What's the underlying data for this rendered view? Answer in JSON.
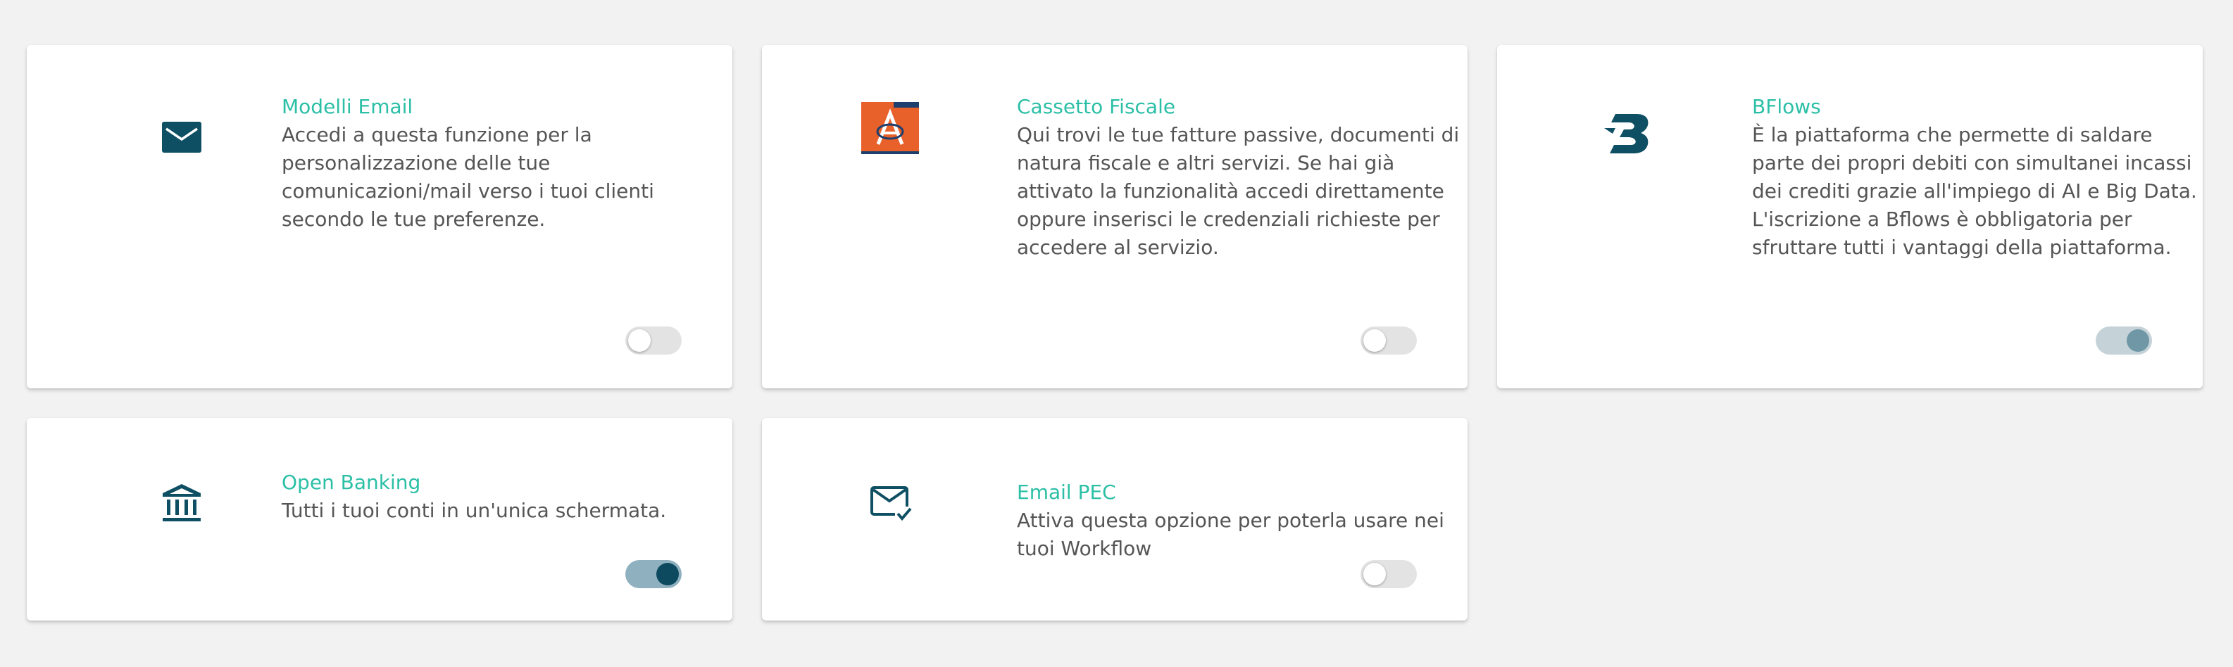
{
  "colors": {
    "background": "#f2f2f2",
    "card": "#ffffff",
    "title": "#2bbfa6",
    "text": "#555555",
    "icon": "#0f4f63",
    "fiscal_orange": "#e8602a"
  },
  "cards": [
    {
      "title": "Modelli Email",
      "description": "Accedi a questa funzione per la personalizzazione delle tue comunicazioni/mail verso i tuoi clienti secondo le tue preferenze.",
      "icon": "envelope-icon",
      "toggle": "off"
    },
    {
      "title": "Cassetto Fiscale",
      "description": "Qui trovi le tue fatture passive, documenti di natura fiscale e altri servizi. Se hai già attivato la funzionalità accedi direttamente oppure inserisci le credenziali richieste per accedere al servizio.",
      "icon": "cassetto-fiscale-logo-icon",
      "toggle": "off"
    },
    {
      "title": "BFlows",
      "description": "È la piattaforma che permette di saldare parte dei propri debiti con simultanei incassi dei crediti grazie all'impiego di AI e Big Data. L'iscrizione a Bflows è obbligatoria per sfruttare tutti i vantaggi della piattaforma.",
      "icon": "bflows-logo-icon",
      "toggle": "on"
    },
    {
      "title": "Open Banking",
      "description": "Tutti i tuoi conti in un'unica schermata.",
      "icon": "bank-icon",
      "toggle": "on"
    },
    {
      "title": "Email PEC",
      "description": "Attiva questa opzione per poterla usare nei tuoi Workflow",
      "icon": "envelope-check-icon",
      "toggle": "off"
    }
  ]
}
